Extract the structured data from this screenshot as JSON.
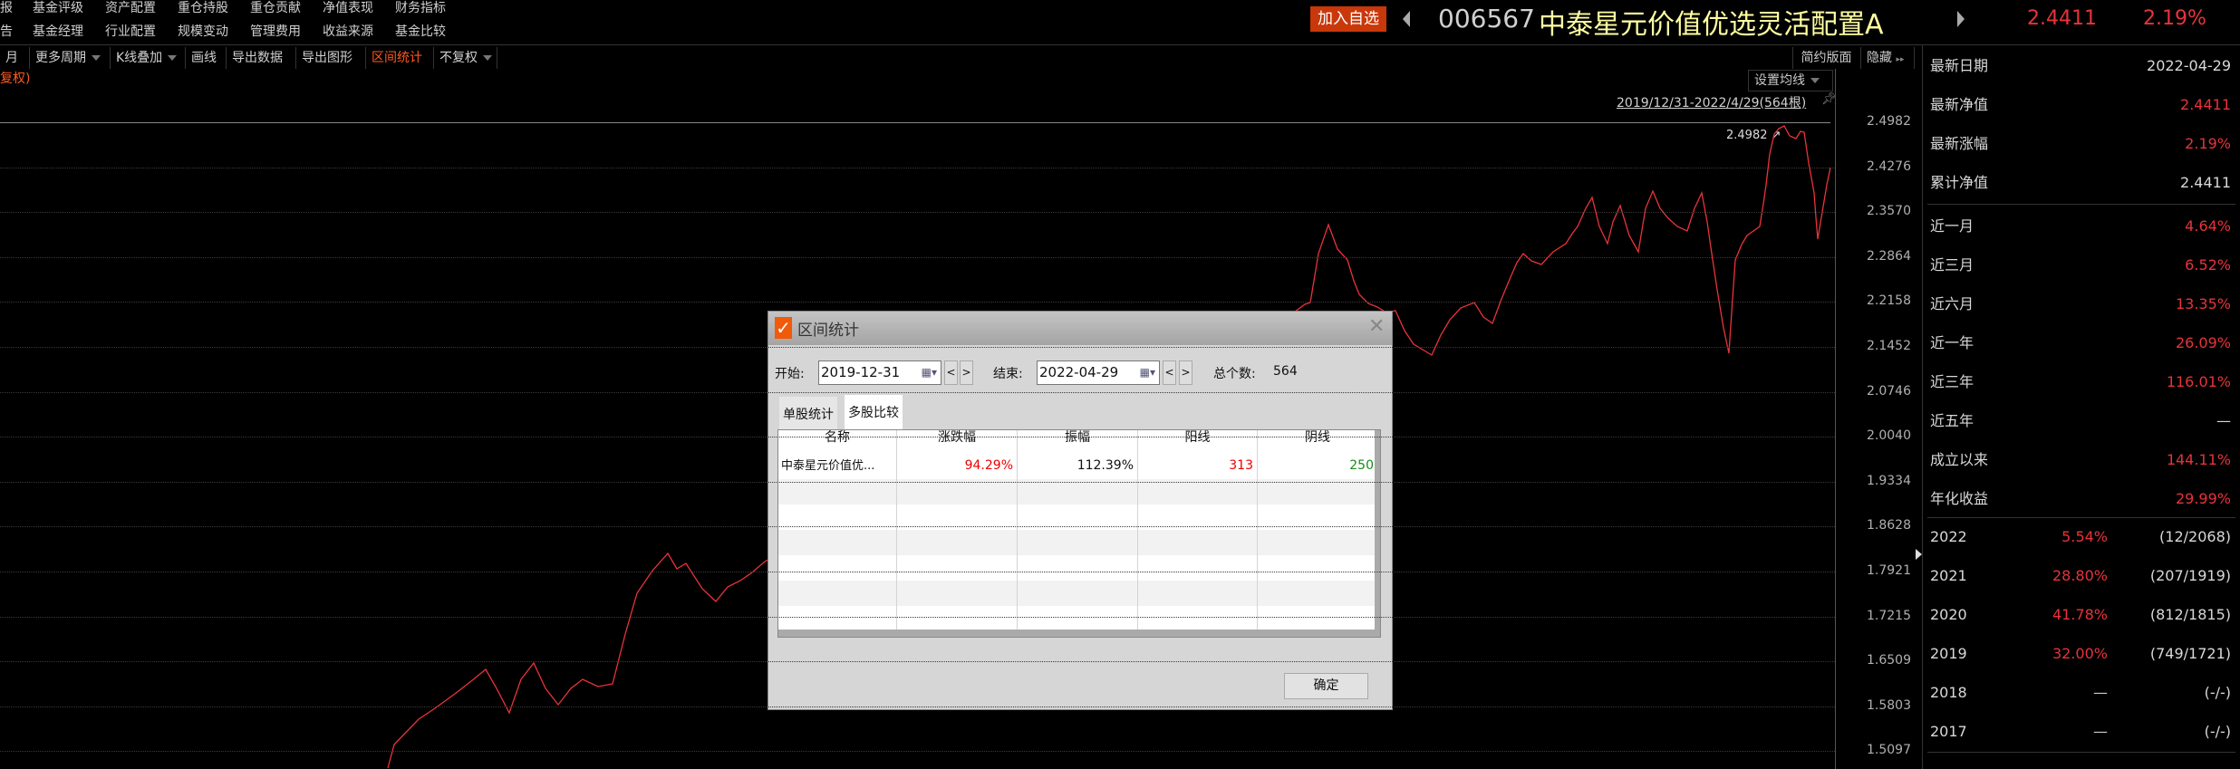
{
  "nav_row1": [
    "报",
    "基金评级",
    "资产配置",
    "重仓持股",
    "重仓贡献",
    "净值表现",
    "财务指标"
  ],
  "nav_row2": [
    "告",
    "基金经理",
    "行业配置",
    "规模变动",
    "管理费用",
    "收益来源",
    "基金比较"
  ],
  "toolbar": [
    "月",
    "更多周期",
    "K线叠加",
    "画线",
    "导出数据",
    "导出图形",
    "区间统计",
    "不复权"
  ],
  "toolbar_right": {
    "simple": "简约版面",
    "hide": "隐藏"
  },
  "adjust_label": "复权)",
  "header": {
    "add_watch": "加入自选",
    "code": "006567",
    "name": "中泰星元价值优选灵活配置A",
    "nav": "2.4411",
    "change": "2.19%"
  },
  "chart": {
    "ma_setting": "设置均线",
    "range_link": "2019/12/31-2022/4/29(564根)",
    "max_label": "2.4982",
    "y_ticks": [
      "2.4982",
      "2.4276",
      "2.3570",
      "2.2864",
      "2.2158",
      "2.1452",
      "2.0746",
      "2.0040",
      "1.9334",
      "1.8628",
      "1.7921",
      "1.7215",
      "1.6509",
      "1.5803",
      "1.5097"
    ]
  },
  "panel": {
    "top": [
      {
        "label": "最新日期",
        "value": "2022-04-29"
      },
      {
        "label": "最新净值",
        "value": "2.4411",
        "red": true
      },
      {
        "label": "最新涨幅",
        "value": "2.19%",
        "red": true
      },
      {
        "label": "累计净值",
        "value": "2.4411"
      }
    ],
    "returns": [
      {
        "label": "近一月",
        "value": "4.64%",
        "red": true
      },
      {
        "label": "近三月",
        "value": "6.52%",
        "red": true
      },
      {
        "label": "近六月",
        "value": "13.35%",
        "red": true
      },
      {
        "label": "近一年",
        "value": "26.09%",
        "red": true
      },
      {
        "label": "近三年",
        "value": "116.01%",
        "red": true
      },
      {
        "label": "近五年",
        "value": "—"
      },
      {
        "label": "成立以来",
        "value": "144.11%",
        "red": true
      },
      {
        "label": "年化收益",
        "value": "29.99%",
        "red": true
      }
    ],
    "years": [
      {
        "year": "2022",
        "ret": "5.54%",
        "rank": "(12/2068)"
      },
      {
        "year": "2021",
        "ret": "28.80%",
        "rank": "(207/1919)"
      },
      {
        "year": "2020",
        "ret": "41.78%",
        "rank": "(812/1815)"
      },
      {
        "year": "2019",
        "ret": "32.00%",
        "rank": "(749/1721)"
      },
      {
        "year": "2018",
        "ret": "—",
        "rank": "(-/-)"
      },
      {
        "year": "2017",
        "ret": "—",
        "rank": "(-/-)"
      }
    ]
  },
  "dialog": {
    "title": "区间统计",
    "start_label": "开始:",
    "start": "2019-12-31",
    "end_label": "结束:",
    "end": "2022-04-29",
    "count_label": "总个数:",
    "count": "564",
    "tabs": [
      "单股统计",
      "多股比较"
    ],
    "columns": [
      "名称",
      "涨跌幅",
      "振幅",
      "阳线",
      "阴线"
    ],
    "rows": [
      {
        "name": "中泰星元价值优...",
        "change": "94.29%",
        "amplitude": "112.39%",
        "up": "313",
        "down": "250"
      }
    ],
    "ok": "确定"
  },
  "colors": {
    "red": "#e8333a",
    "orange": "#ff5a1f",
    "green": "#1a8a1a",
    "name": "#ffffa0"
  }
}
